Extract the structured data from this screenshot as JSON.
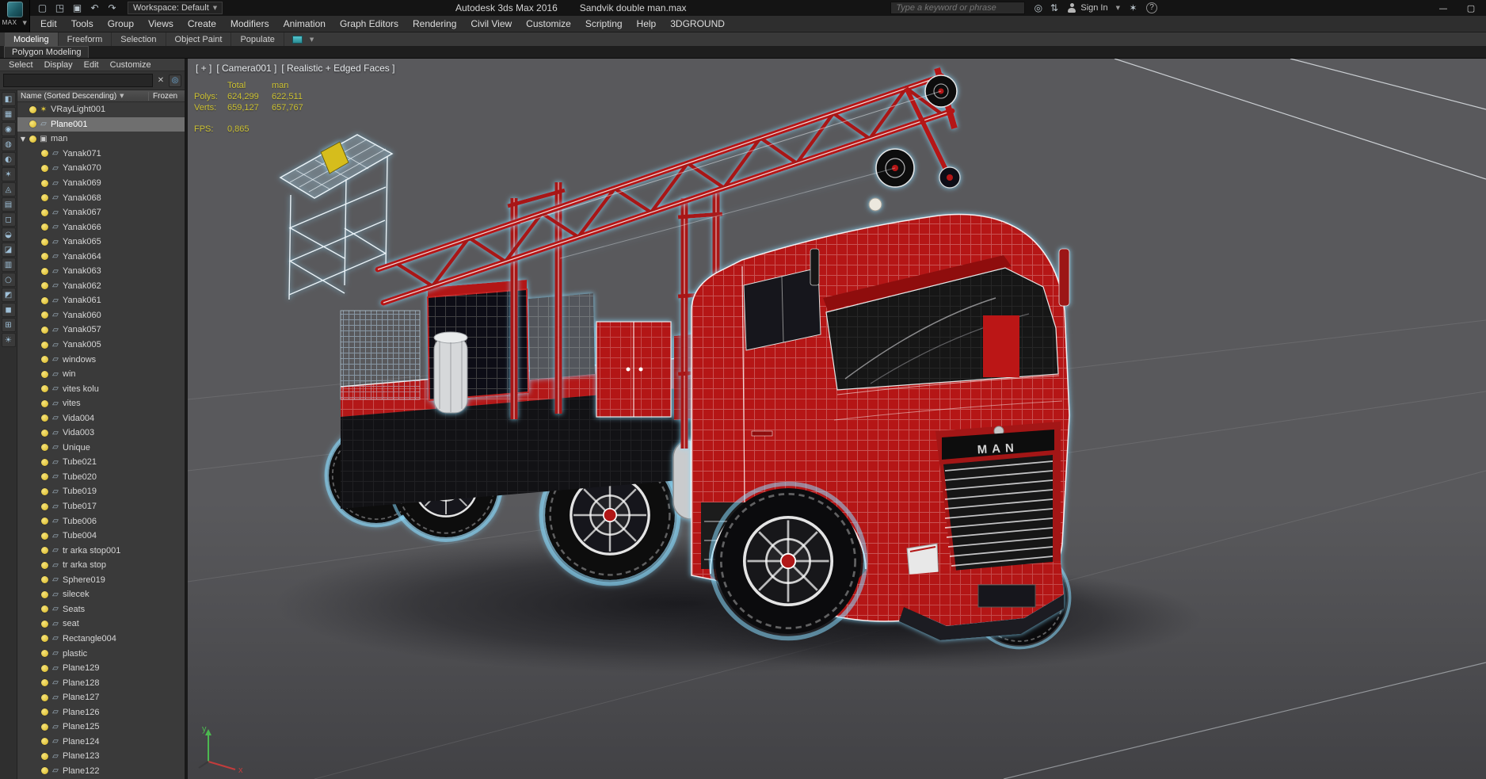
{
  "titlebar": {
    "logo_text": "MAX",
    "quick_icons": [
      {
        "glyph": "▢"
      },
      {
        "glyph": "◳"
      },
      {
        "glyph": "▣"
      },
      {
        "glyph": "↶"
      },
      {
        "glyph": "↷"
      }
    ],
    "workspace_label": "Workspace:",
    "workspace_value": "Default",
    "app_title": "Autodesk 3ds Max 2016",
    "document_title": "Sandvik double man.max",
    "search_placeholder": "Type a keyword or phrase",
    "search_icons": [
      {
        "glyph": "◎"
      },
      {
        "glyph": "⇅"
      }
    ],
    "sign_in_label": "Sign In",
    "comm_glyph": "✶",
    "help_glyph": "?",
    "minimize_glyph": "—",
    "maximize_glyph": "▢"
  },
  "menubar": {
    "items": [
      {
        "label": "Edit"
      },
      {
        "label": "Tools"
      },
      {
        "label": "Group"
      },
      {
        "label": "Views"
      },
      {
        "label": "Create"
      },
      {
        "label": "Modifiers"
      },
      {
        "label": "Animation"
      },
      {
        "label": "Graph Editors"
      },
      {
        "label": "Rendering"
      },
      {
        "label": "Civil View"
      },
      {
        "label": "Customize"
      },
      {
        "label": "Scripting"
      },
      {
        "label": "Help"
      },
      {
        "label": "3DGROUND"
      }
    ]
  },
  "ribbon": {
    "tabs": [
      {
        "label": "Modeling",
        "active": true
      },
      {
        "label": "Freeform"
      },
      {
        "label": "Selection"
      },
      {
        "label": "Object Paint"
      },
      {
        "label": "Populate"
      }
    ],
    "panel_tab": "Polygon Modeling"
  },
  "explorer": {
    "menu": [
      {
        "label": "Select"
      },
      {
        "label": "Display"
      },
      {
        "label": "Edit"
      },
      {
        "label": "Customize"
      }
    ],
    "search_value": "",
    "clear_glyph": "✕",
    "filter_glyph": "◎",
    "header_name": "Name (Sorted Descending)",
    "header_caret": "▼",
    "header_frozen": "Frozen",
    "toolstrip": [
      {
        "glyph": "◧"
      },
      {
        "glyph": "▦"
      },
      {
        "glyph": "◉"
      },
      {
        "glyph": "◍"
      },
      {
        "glyph": "◐"
      },
      {
        "glyph": "✶"
      },
      {
        "glyph": "◬"
      },
      {
        "glyph": "▤"
      },
      {
        "glyph": "◻"
      },
      {
        "glyph": "◒"
      },
      {
        "glyph": "◪"
      },
      {
        "glyph": "▥"
      },
      {
        "glyph": "○"
      },
      {
        "glyph": "◩"
      },
      {
        "glyph": "◼"
      },
      {
        "glyph": "⊞"
      },
      {
        "glyph": "☀"
      }
    ],
    "items": [
      {
        "label": "VRayLight001",
        "type": "light",
        "level": 0
      },
      {
        "label": "Plane001",
        "type": "geom",
        "level": 0,
        "selected": true
      },
      {
        "label": "man",
        "type": "group",
        "level": 0,
        "expanded": true
      },
      {
        "label": "Yanak071",
        "type": "geom",
        "level": 1
      },
      {
        "label": "Yanak070",
        "type": "geom",
        "level": 1
      },
      {
        "label": "Yanak069",
        "type": "geom",
        "level": 1
      },
      {
        "label": "Yanak068",
        "type": "geom",
        "level": 1
      },
      {
        "label": "Yanak067",
        "type": "geom",
        "level": 1
      },
      {
        "label": "Yanak066",
        "type": "geom",
        "level": 1
      },
      {
        "label": "Yanak065",
        "type": "geom",
        "level": 1
      },
      {
        "label": "Yanak064",
        "type": "geom",
        "level": 1
      },
      {
        "label": "Yanak063",
        "type": "geom",
        "level": 1
      },
      {
        "label": "Yanak062",
        "type": "geom",
        "level": 1
      },
      {
        "label": "Yanak061",
        "type": "geom",
        "level": 1
      },
      {
        "label": "Yanak060",
        "type": "geom",
        "level": 1
      },
      {
        "label": "Yanak057",
        "type": "geom",
        "level": 1
      },
      {
        "label": "Yanak005",
        "type": "geom",
        "level": 1
      },
      {
        "label": "windows",
        "type": "geom",
        "level": 1
      },
      {
        "label": "win",
        "type": "geom",
        "level": 1
      },
      {
        "label": "vites kolu",
        "type": "geom",
        "level": 1
      },
      {
        "label": "vites",
        "type": "geom",
        "level": 1
      },
      {
        "label": "Vida004",
        "type": "geom",
        "level": 1
      },
      {
        "label": "Vida003",
        "type": "geom",
        "level": 1
      },
      {
        "label": "Unique",
        "type": "geom",
        "level": 1
      },
      {
        "label": "Tube021",
        "type": "geom",
        "level": 1
      },
      {
        "label": "Tube020",
        "type": "geom",
        "level": 1
      },
      {
        "label": "Tube019",
        "type": "geom",
        "level": 1
      },
      {
        "label": "Tube017",
        "type": "geom",
        "level": 1
      },
      {
        "label": "Tube006",
        "type": "geom",
        "level": 1
      },
      {
        "label": "Tube004",
        "type": "geom",
        "level": 1
      },
      {
        "label": "tr arka stop001",
        "type": "geom",
        "level": 1
      },
      {
        "label": "tr arka stop",
        "type": "geom",
        "level": 1
      },
      {
        "label": "Sphere019",
        "type": "geom",
        "level": 1
      },
      {
        "label": "silecek",
        "type": "geom",
        "level": 1
      },
      {
        "label": "Seats",
        "type": "geom",
        "level": 1
      },
      {
        "label": "seat",
        "type": "geom",
        "level": 1
      },
      {
        "label": "Rectangle004",
        "type": "geom",
        "level": 1
      },
      {
        "label": "plastic",
        "type": "geom",
        "level": 1
      },
      {
        "label": "Plane129",
        "type": "geom",
        "level": 1
      },
      {
        "label": "Plane128",
        "type": "geom",
        "level": 1
      },
      {
        "label": "Plane127",
        "type": "geom",
        "level": 1
      },
      {
        "label": "Plane126",
        "type": "geom",
        "level": 1
      },
      {
        "label": "Plane125",
        "type": "geom",
        "level": 1
      },
      {
        "label": "Plane124",
        "type": "geom",
        "level": 1
      },
      {
        "label": "Plane123",
        "type": "geom",
        "level": 1
      },
      {
        "label": "Plane122",
        "type": "geom",
        "level": 1
      }
    ]
  },
  "viewport": {
    "label_general": "[ + ]",
    "label_pov": "[ Camera001 ]",
    "label_shading": "[ Realistic + Edged Faces ]",
    "stats": {
      "col_total": "Total",
      "col_selection": "man",
      "polys_label": "Polys:",
      "polys_total": "624,299",
      "polys_selection": "622,511",
      "verts_label": "Verts:",
      "verts_total": "659,127",
      "verts_selection": "657,767",
      "fps_label": "FPS:",
      "fps_value": "0,865"
    },
    "axis_x": "x",
    "axis_y": "y",
    "badge": "MAN"
  },
  "colors": {
    "accent_red": "#b51818",
    "selection_glow": "#8adcff",
    "stat_yellow": "#cdc233"
  }
}
